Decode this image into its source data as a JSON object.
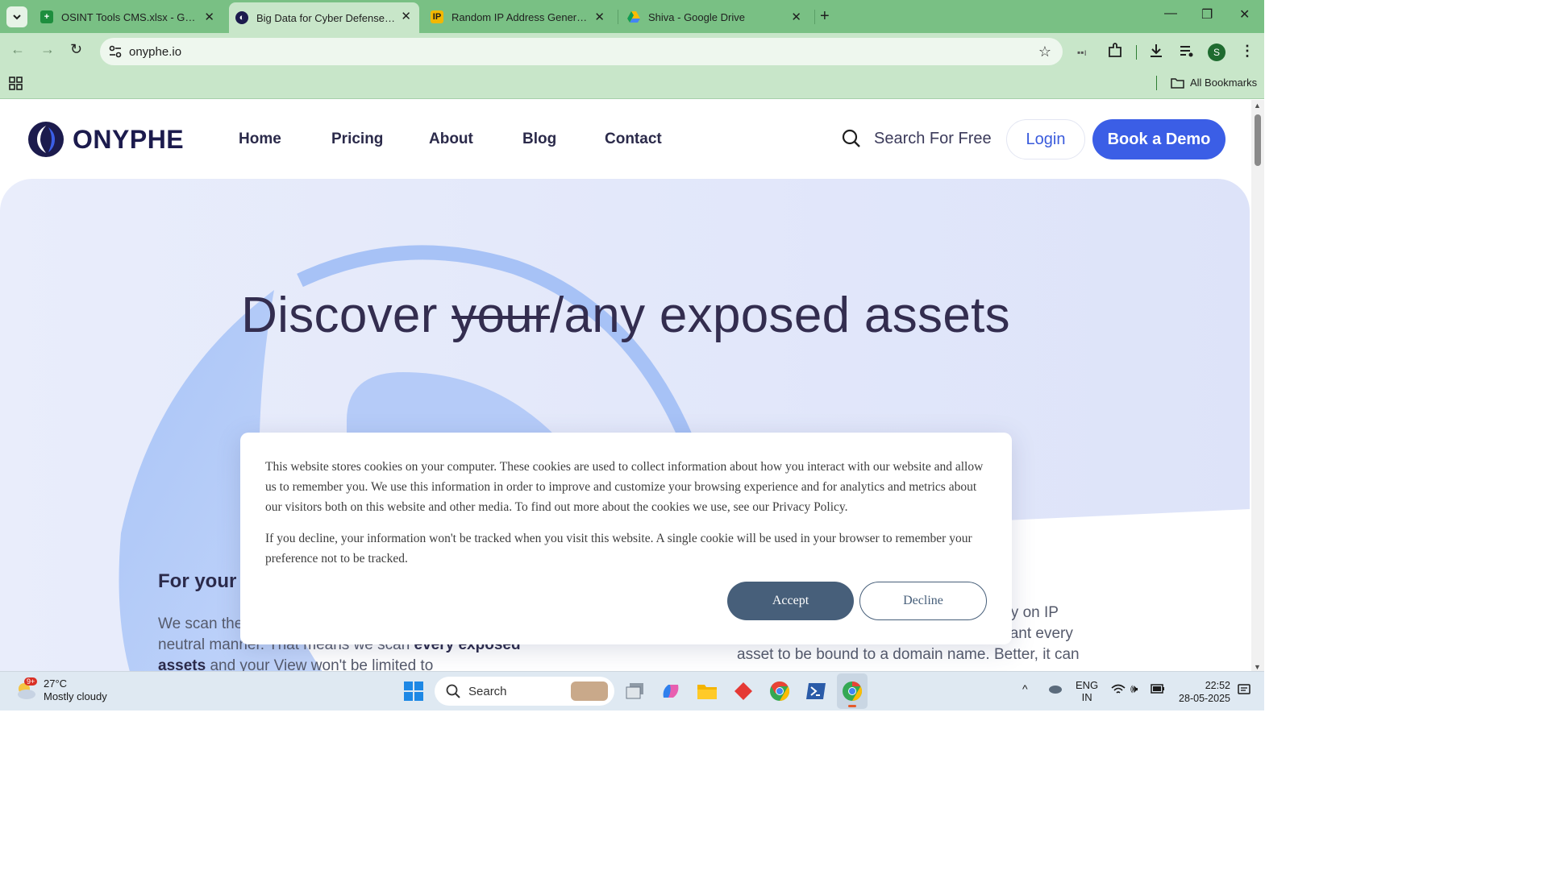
{
  "browser": {
    "tabs": [
      {
        "title": "OSINT Tools CMS.xlsx - Google",
        "favicon": "sheets-icon",
        "active": false
      },
      {
        "title": "Big Data for Cyber Defense | Ol",
        "favicon": "onyphe-icon",
        "active": true
      },
      {
        "title": "Random IP Address Generator,",
        "favicon": "ip-icon",
        "active": false
      },
      {
        "title": "Shiva - Google Drive",
        "favicon": "drive-icon",
        "active": false
      }
    ],
    "url": "onyphe.io",
    "profile_initial": "S",
    "bookmarks_label": "All Bookmarks"
  },
  "site": {
    "logo_text": "ONYPHE",
    "nav": [
      "Home",
      "Pricing",
      "About",
      "Blog",
      "Contact"
    ],
    "search_label": "Search For Free",
    "login_label": "Login",
    "demo_label": "Book a Demo"
  },
  "hero": {
    "title_pre": "Discover ",
    "title_strike": "your",
    "title_post": "/any exposed assets",
    "left_heading": "For your",
    "left_body_1": "We scan the",
    "left_body_2": "neutral manner. That means we scan ",
    "left_body_bold": "every exposed assets",
    "left_body_3": " and your View won't be limited to",
    "right_body_1": "ely on IP",
    "right_body_2": "want every",
    "right_body_3": "asset to be bound to a domain name. Better, it can"
  },
  "cookie": {
    "p1": "This website stores cookies on your computer. These cookies are used to collect information about how you interact with our website and allow us to remember you. We use this information in order to improve and customize your browsing experience and for analytics and metrics about our visitors both on this website and other media. To find out more about the cookies we use, see our Privacy Policy.",
    "p2": "If you decline, your information won't be tracked when you visit this website. A single cookie will be used in your browser to remember your preference not to be tracked.",
    "accept": "Accept",
    "decline": "Decline"
  },
  "taskbar": {
    "weather_badge": "9+",
    "temperature": "27°C",
    "weather_desc": "Mostly cloudy",
    "search_label": "Search",
    "lang_1": "ENG",
    "lang_2": "IN",
    "time": "22:52",
    "date": "28-05-2025"
  },
  "colors": {
    "tabstrip": "#79c084",
    "toolbar": "#c8e6c9",
    "brand_blue": "#3b5ee6",
    "hero_text": "#332d4f",
    "accept_btn": "#475f7a"
  }
}
